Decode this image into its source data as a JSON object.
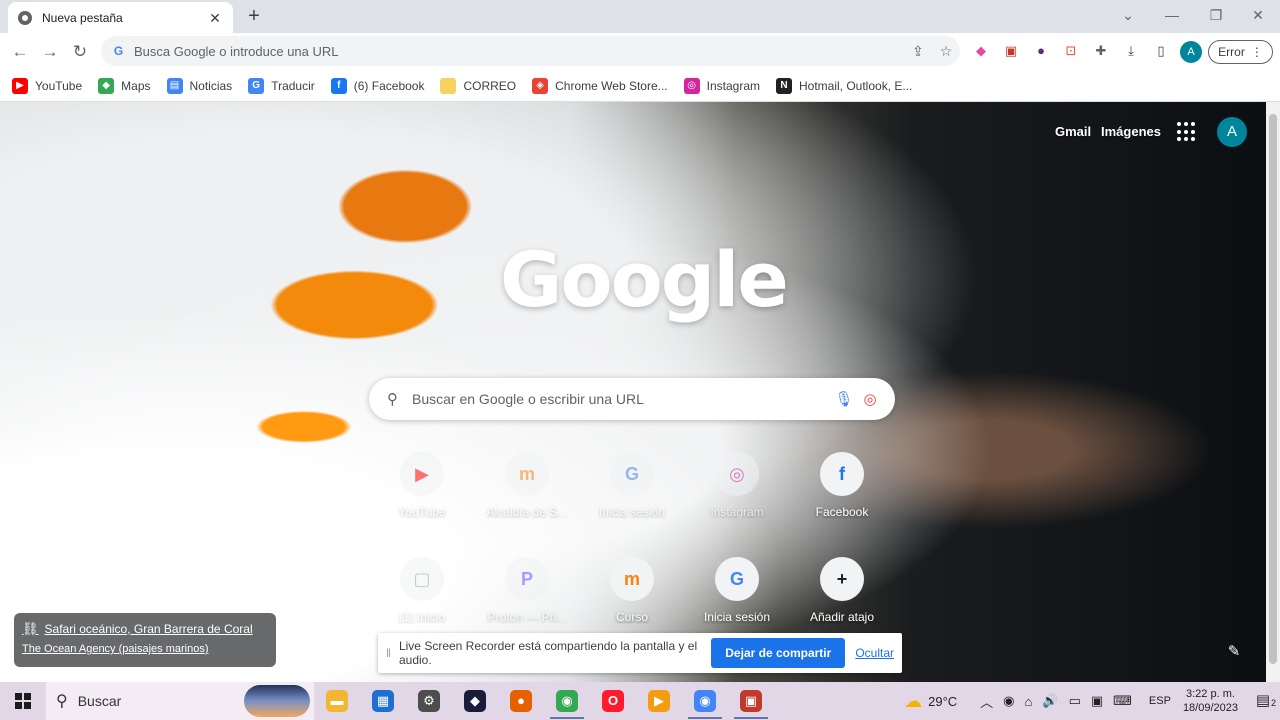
{
  "tab": {
    "title": "Nueva pestaña",
    "close": "✕",
    "new": "+"
  },
  "window": {
    "minimize": "—",
    "restore": "❐",
    "close": "✕",
    "collapse": "⌄"
  },
  "toolbar": {
    "back": "←",
    "forward": "→",
    "reload": "↻",
    "omnibox_placeholder": "Busca Google o introduce una URL",
    "profile_initial": "A",
    "error_label": "Error",
    "menu": "⋮"
  },
  "bookmarks": [
    {
      "label": "YouTube",
      "icon": "youtube-icon",
      "color": "#ff0000",
      "glyph": "▶"
    },
    {
      "label": "Maps",
      "icon": "maps-icon",
      "color": "#34a853",
      "glyph": "◆"
    },
    {
      "label": "Noticias",
      "icon": "news-icon",
      "color": "#4285f4",
      "glyph": "▤"
    },
    {
      "label": "Traducir",
      "icon": "translate-icon",
      "color": "#4285f4",
      "glyph": "G"
    },
    {
      "label": "(6) Facebook",
      "icon": "facebook-icon",
      "color": "#1877f2",
      "glyph": "f"
    },
    {
      "label": "CORREO",
      "icon": "folder-icon",
      "color": "#f4d35e",
      "glyph": ""
    },
    {
      "label": "Chrome Web Store...",
      "icon": "webstore-icon",
      "color": "#ea4335",
      "glyph": "◈"
    },
    {
      "label": "Instagram",
      "icon": "instagram-icon",
      "color": "#d6249f",
      "glyph": "◎"
    },
    {
      "label": "Hotmail, Outlook, E...",
      "icon": "outlook-icon",
      "color": "#202124",
      "glyph": "N"
    }
  ],
  "ntp": {
    "gmail": "Gmail",
    "images": "Imágenes",
    "avatar": "A",
    "logo": "Google",
    "search_placeholder": "Buscar en Google o escribir una URL",
    "tiles": [
      {
        "label": "YouTube",
        "icon": "youtube-icon",
        "glyph": "▶",
        "color": "#ff0000",
        "faded": true
      },
      {
        "label": "Alcaldía de S...",
        "icon": "moodle-icon",
        "glyph": "m",
        "color": "#f98012",
        "faded": true
      },
      {
        "label": "Inicia sesión",
        "icon": "google-icon",
        "glyph": "G",
        "color": "#4285f4",
        "faded": true
      },
      {
        "label": "Instagram",
        "icon": "instagram-icon",
        "glyph": "◎",
        "color": "#d6249f",
        "faded": true
      },
      {
        "label": "Facebook",
        "icon": "facebook-icon",
        "glyph": "f",
        "color": "#1877f2",
        "faded": false
      },
      {
        "label": "(1) Inicio",
        "icon": "generic-site-icon",
        "glyph": "▢",
        "color": "#9aa0a6",
        "faded": true
      },
      {
        "label": "Proton — Pri...",
        "icon": "proton-icon",
        "glyph": "P",
        "color": "#6d4aff",
        "faded": true
      },
      {
        "label": "Curso",
        "icon": "moodle-icon",
        "glyph": "m",
        "color": "#f98012",
        "faded": false
      },
      {
        "label": "Inicia sesión",
        "icon": "google-icon",
        "glyph": "G",
        "color": "#4285f4",
        "faded": false
      },
      {
        "label": "Añadir atajo",
        "icon": "plus-icon",
        "glyph": "+",
        "color": "#202124",
        "faded": false
      }
    ],
    "attribution_title": "Safari oceánico, Gran Barrera de Coral",
    "attribution_author": "The Ocean Agency (paisajes marinos)"
  },
  "share_bar": {
    "message": "Live Screen Recorder está compartiendo la pantalla y el audio.",
    "stop": "Dejar de compartir",
    "hide": "Ocultar"
  },
  "taskbar": {
    "search": "Buscar",
    "weather": "29°C",
    "lang": "ESP",
    "time": "3:22 p. m.",
    "date": "18/09/2023",
    "notifications": "2",
    "apps": [
      {
        "icon": "file-explorer-icon",
        "color": "#f2b632",
        "glyph": "▬",
        "active": false
      },
      {
        "icon": "store-icon",
        "color": "#1f6fd1",
        "glyph": "▦",
        "active": false
      },
      {
        "icon": "settings-icon",
        "color": "#4d4d4d",
        "glyph": "⚙",
        "active": false
      },
      {
        "icon": "media-app-icon",
        "color": "#1b1b3a",
        "glyph": "◆",
        "active": false
      },
      {
        "icon": "firefox-icon",
        "color": "#e66000",
        "glyph": "●",
        "active": false
      },
      {
        "icon": "chrome-icon",
        "color": "#34a853",
        "glyph": "◉",
        "active": true
      },
      {
        "icon": "opera-icon",
        "color": "#ff1b2d",
        "glyph": "O",
        "active": false
      },
      {
        "icon": "video-app-icon",
        "color": "#f39c12",
        "glyph": "▶",
        "active": false
      },
      {
        "icon": "chrome-icon",
        "color": "#4285f4",
        "glyph": "◉",
        "active": true
      },
      {
        "icon": "screen-recorder-icon",
        "color": "#c0392b",
        "glyph": "▣",
        "active": true
      }
    ]
  }
}
